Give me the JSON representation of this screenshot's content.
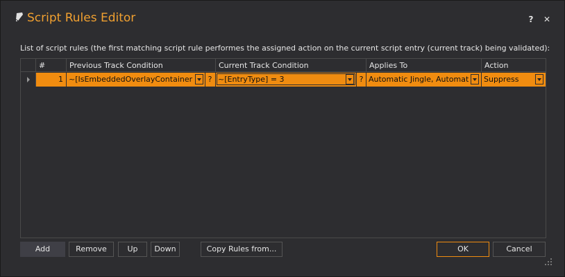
{
  "window": {
    "title": "Script Rules Editor",
    "help_label": "?",
    "close_label": "✕"
  },
  "description": "List of script rules (the first matching script rule performes the assigned action on the current script entry (current track) being validated):",
  "grid": {
    "columns": [
      "#",
      "Previous Track Condition",
      "Current Track Condition",
      "Applies To",
      "Action"
    ],
    "rows": [
      {
        "num": "1",
        "previous": "~[IsEmbeddedOverlayContainer] = ...",
        "current": "~[EntryType] = 3",
        "applies": "Automatic Jingle, Automatic...",
        "action": "Suppress",
        "help": "?"
      }
    ]
  },
  "buttons": {
    "add": "Add",
    "remove": "Remove",
    "up": "Up",
    "down": "Down",
    "copy": "Copy Rules from...",
    "ok": "OK",
    "cancel": "Cancel"
  },
  "colors": {
    "accent": "#f08c10",
    "title": "#f0a030",
    "background": "#2d2d30"
  }
}
